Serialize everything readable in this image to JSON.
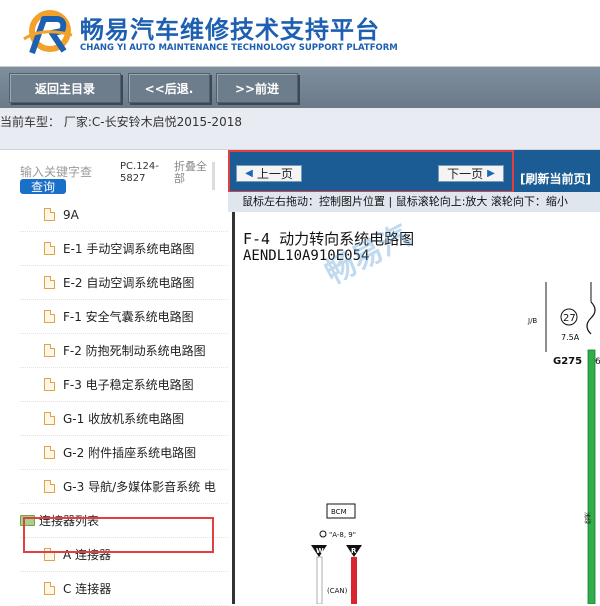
{
  "brand": {
    "title_cn": "畅易汽车维修技术支持平台",
    "title_en": "CHANG YI AUTO MAINTENANCE TECHNOLOGY SUPPORT PLATFORM"
  },
  "toolbar": {
    "home_label": "返回主目录",
    "back_label": "<<后退.",
    "forward_label": ">>前进"
  },
  "vehicle": {
    "label": "当前车型： 厂家:C-长安铃木启悦2015-2018"
  },
  "sidebar": {
    "search_placeholder": "输入关键字查",
    "query_label": "查询",
    "pc_code": "PC.124-5827",
    "fold_all": "折叠全部",
    "items": [
      {
        "label": "9A",
        "type": "file"
      },
      {
        "label": "E-1 手动空调系统电路图",
        "type": "file"
      },
      {
        "label": "E-2 自动空调系统电路图",
        "type": "file"
      },
      {
        "label": "F-1 安全气囊系统电路图",
        "type": "file"
      },
      {
        "label": "F-2 防抱死制动系统电路图",
        "type": "file"
      },
      {
        "label": "F-3 电子稳定系统电路图",
        "type": "file"
      },
      {
        "label": "G-1 收放机系统电路图",
        "type": "file"
      },
      {
        "label": "G-2 附件插座系统电路图",
        "type": "file"
      },
      {
        "label": "G-3 导航/多媒体影音系统 电",
        "type": "file"
      },
      {
        "label": "连接器列表",
        "type": "folder"
      },
      {
        "label": "A 连接器",
        "type": "file"
      },
      {
        "label": "C 连接器",
        "type": "file"
      }
    ]
  },
  "viewer": {
    "prev_label": "上一页",
    "next_label": "下一页",
    "refresh_label": "[刷新当前页]",
    "hint": "鼠标左右拖动：控制图片位置 | 鼠标滚轮向上:放大  滚轮向下：缩小",
    "diagram_title": "F-4 动力转向系统电路图",
    "diagram_code": "AENDL10A910E054",
    "watermark": "畅易汽",
    "labels": {
      "jb": "J/B",
      "fuse_no": "27",
      "fuse_amp": "7.5A",
      "ground": "G275",
      "bcm": "BCM",
      "bcm_pins": "\"A-8, 9\"",
      "pin_w": "W",
      "pin_r": "R",
      "can": "(CAN)",
      "side_text": "浅绿",
      "partial": "6"
    }
  },
  "colors": {
    "brand_blue": "#1d5fb0",
    "toolbar_gray": "#6e7d8c",
    "nav_blue": "#1b5c94",
    "highlight_red": "#e04040",
    "wire_green": "#2fae4a",
    "wire_red": "#d9262e"
  }
}
